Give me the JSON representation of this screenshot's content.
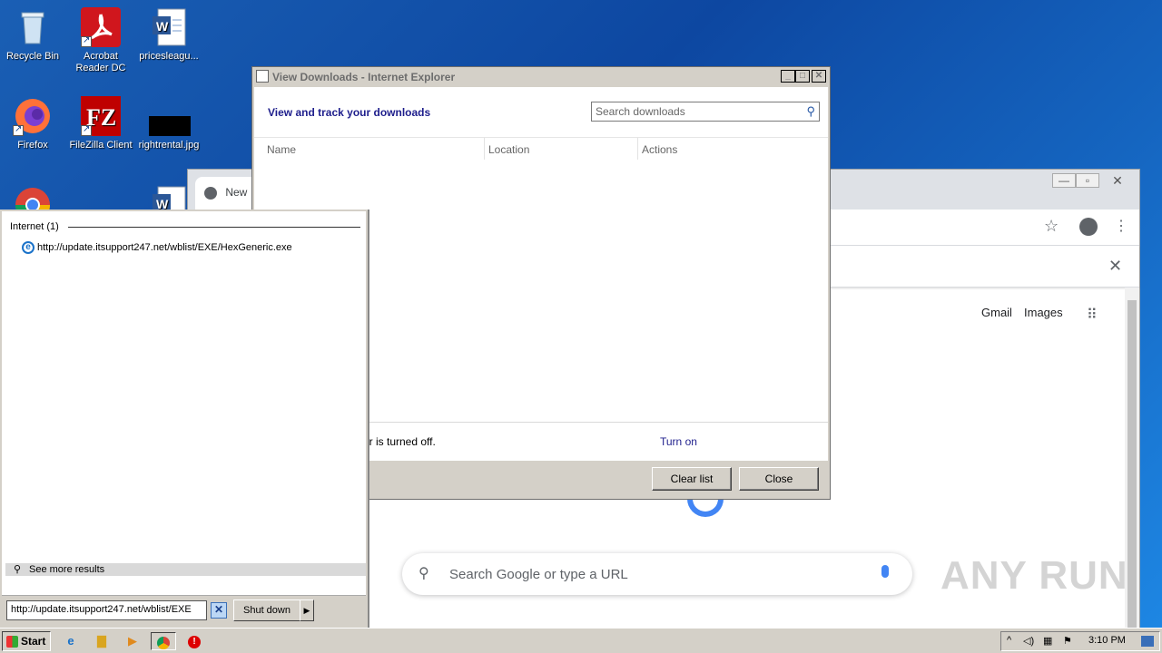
{
  "desktop": {
    "icons": [
      {
        "label": "Recycle Bin",
        "icon": "recycle-bin-icon"
      },
      {
        "label": "Acrobat Reader DC",
        "icon": "acrobat-icon"
      },
      {
        "label": "pricesleagu...",
        "icon": "word-doc-icon"
      },
      {
        "label": "Firefox",
        "icon": "firefox-icon"
      },
      {
        "label": "FileZilla Client",
        "icon": "filezilla-icon"
      },
      {
        "label": "rightrental.jpg",
        "icon": "image-file-icon"
      }
    ]
  },
  "chrome": {
    "tab_label": "New",
    "gmail": "Gmail",
    "images": "Images",
    "search_placeholder": "Search Google or type a URL"
  },
  "downloads_dialog": {
    "title": "View Downloads - Internet Explorer",
    "heading": "View and track your downloads",
    "search_placeholder": "Search downloads",
    "columns": [
      "Name",
      "Location",
      "Actions"
    ],
    "status_text": "er is turned off.",
    "turn_on": "Turn on",
    "clear_list": "Clear list",
    "close": "Close"
  },
  "start_menu": {
    "group_header": "Internet (1)",
    "result": "http://update.itsupport247.net/wblist/EXE/HexGeneric.exe",
    "see_more": "See more results",
    "search_value": "http://update.itsupport247.net/wblist/EXE",
    "shut_down": "Shut down"
  },
  "taskbar": {
    "start": "Start",
    "clock": "3:10 PM"
  },
  "watermark": "ANY RUN"
}
